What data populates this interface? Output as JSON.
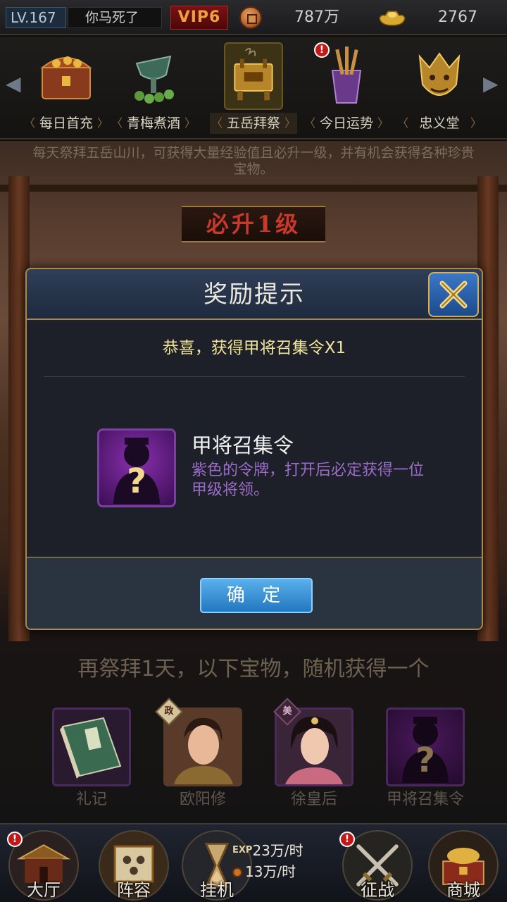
{
  "topbar": {
    "level": "LV.167",
    "player_name": "你马死了",
    "vip": "VIP6",
    "coins": "787万",
    "gold": "2767"
  },
  "tabs": [
    {
      "label": "每日首充",
      "icon": "treasure-chest-icon",
      "alert": false
    },
    {
      "label": "青梅煮酒",
      "icon": "wine-vessel-icon",
      "alert": false
    },
    {
      "label": "五岳拜祭",
      "icon": "incense-burner-icon",
      "alert": false,
      "active": true
    },
    {
      "label": "今日运势",
      "icon": "fortune-sticks-icon",
      "alert": true
    },
    {
      "label": "忠义堂",
      "icon": "dragon-head-icon",
      "alert": false
    }
  ],
  "scene": {
    "description": "每天祭拜五岳山川，可获得大量经验值且必升一级，并有机会获得各种珍贵宝物。",
    "banner": "必升1级"
  },
  "modal": {
    "title": "奖励提示",
    "congrats": "恭喜，获得甲将召集令X1",
    "item_name": "甲将召集令",
    "item_desc": "紫色的令牌，打开后必定获得一位甲级将领。",
    "confirm": "确 定"
  },
  "next": {
    "text": "再祭拜1天，以下宝物，随机获得一个",
    "rewards": [
      {
        "name": "礼记",
        "icon": "book-icon"
      },
      {
        "name": "欧阳修",
        "icon": "general-portrait-icon",
        "tag": "政"
      },
      {
        "name": "徐皇后",
        "icon": "empress-portrait-icon",
        "tag": "美"
      },
      {
        "name": "甲将召集令",
        "icon": "mystery-token-icon"
      }
    ]
  },
  "bottom_nav": {
    "hall": "大厅",
    "formation": "阵容",
    "afk": "挂机",
    "afk_exp_label": "EXP",
    "afk_exp_rate": "23万/时",
    "afk_coin_rate": "13万/时",
    "battle": "征战",
    "shop": "商城"
  },
  "colors": {
    "accent_gold": "#a88a4c",
    "confirm_blue": "#2278c0",
    "item_purple": "#9b6cc8",
    "congrats_yellow": "#f0e49a",
    "alert_red": "#c21818"
  }
}
